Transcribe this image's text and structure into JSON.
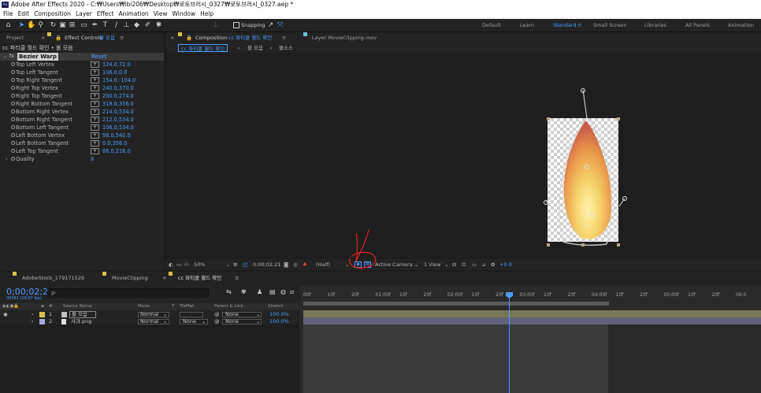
{
  "titlebar": {
    "app_badge": "Ae",
    "title": "Adobe After Effects 2020 - C:₩Users₩ibi206₩Desktop₩로토브러시_0327₩로토브러시_0327.aep *"
  },
  "menu": [
    "File",
    "Edit",
    "Composition",
    "Layer",
    "Effect",
    "Animation",
    "View",
    "Window",
    "Help"
  ],
  "toolbar": {
    "snapping_label": "Snapping",
    "workspaces": [
      "Default",
      "Learn",
      "Standard",
      "Small Screen",
      "Libraries",
      "All Panels",
      "Animation"
    ],
    "active_workspace": "Standard"
  },
  "effect_controls": {
    "tab_project": "Project",
    "tab_label": "Effect Controls",
    "tab_layer": "불 모음",
    "breadcrumb": "cc 파티클 월드 확인 • 불 모음",
    "effect_name": "Bezier Warp",
    "reset_label": "Reset",
    "properties": [
      {
        "name": "Top Left Vertex",
        "value": "124.0,72.0"
      },
      {
        "name": "Top Left Tangent",
        "value": "106.0,0.0"
      },
      {
        "name": "Top Right Tangent",
        "value": "154.0,-104.0"
      },
      {
        "name": "Right Top Vertex",
        "value": "240.0,370.0"
      },
      {
        "name": "Right Top Tangent",
        "value": "200.0,274.0"
      },
      {
        "name": "Right Bottom Tangent",
        "value": "318.0,356.0"
      },
      {
        "name": "Bottom Right Vertex",
        "value": "214.0,534.0"
      },
      {
        "name": "Bottom Right Tangent",
        "value": "212.0,534.0"
      },
      {
        "name": "Bottom Left Tangent",
        "value": "106.0,534.0"
      },
      {
        "name": "Left Bottom Vertex",
        "value": "98.0,540.0"
      },
      {
        "name": "Left Bottom Tangent",
        "value": "0.0,356.0"
      },
      {
        "name": "Left Top Tangent",
        "value": "86.0,216.0"
      }
    ],
    "quality_label": "Quality",
    "quality_value": "8"
  },
  "composition": {
    "tab_label": "Composition",
    "tab_name": "cc 파티클 월드 확인",
    "layer_tab": "Layer MovieClipping.mov",
    "nav_active": "cc 파티클 월드 확인",
    "nav_items": [
      "불 모음",
      "불소스"
    ],
    "bottom": {
      "zoom": "50%",
      "timecode": "0;00;02;21",
      "resolution": "(Half)",
      "camera": "Active Camera",
      "view": "1 View",
      "exposure": "+0.0"
    }
  },
  "timeline": {
    "tabs": [
      "AdobeStock_179171529",
      "MovieClipping",
      "cc 파티클 월드 확인"
    ],
    "active_tab": "cc 파티클 월드 확인",
    "current_time": "0;00;02;21",
    "frames": "00081 (29.97 fps)",
    "search_placeholder": "ρ⋅",
    "columns": [
      "#",
      "Source Name",
      "Mode",
      "T",
      "TrkMat",
      "Parent & Link",
      "Stretch"
    ],
    "layers": [
      {
        "index": "1",
        "name": "불 모음",
        "mode": "Normal",
        "trkmat": "",
        "parent": "None",
        "stretch": "100.0%"
      },
      {
        "index": "2",
        "name": "사과.png",
        "mode": "Normal",
        "trkmat": "None",
        "parent": "None",
        "stretch": "100.0%"
      }
    ],
    "ruler_labels": [
      "00f",
      "10f",
      "20f",
      "01:00f",
      "10f",
      "20f",
      "02:00f",
      "10f",
      "20f",
      "03:00f",
      "10f",
      "20f",
      "04:00f",
      "10f",
      "20f",
      "05:00f",
      "10f",
      "20f",
      "06:0"
    ]
  },
  "colors": {
    "accent": "#4d9bff",
    "panel": "#232323",
    "annotation": "#e02020"
  }
}
